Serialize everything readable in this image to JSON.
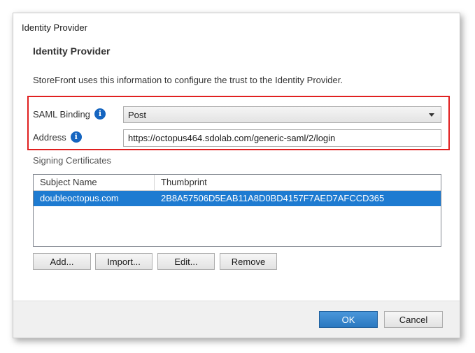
{
  "window": {
    "title": "Identity Provider"
  },
  "section": {
    "title": "Identity Provider",
    "description": "StoreFront uses this information to configure the trust to the Identity Provider."
  },
  "saml_binding": {
    "label": "SAML Binding",
    "value": "Post",
    "info_icon": "info-icon"
  },
  "address": {
    "label": "Address",
    "value": "https://octopus464.sdolab.com/generic-saml/2/login",
    "info_icon": "info-icon"
  },
  "certificates": {
    "label": "Signing Certificates",
    "columns": [
      "Subject Name",
      "Thumbprint"
    ],
    "rows": [
      {
        "subject": "doubleoctopus.com",
        "thumbprint": "2B8A57506D5EAB11A8D0BD4157F7AED7AFCCD365"
      }
    ]
  },
  "buttons": {
    "add": "Add...",
    "import": "Import...",
    "edit": "Edit...",
    "remove": "Remove"
  },
  "footer": {
    "ok": "OK",
    "cancel": "Cancel"
  },
  "colors": {
    "highlight": "#e02020",
    "selection": "#1e7bd1",
    "info": "#1565c0",
    "ok_button": "#2a78c0"
  }
}
